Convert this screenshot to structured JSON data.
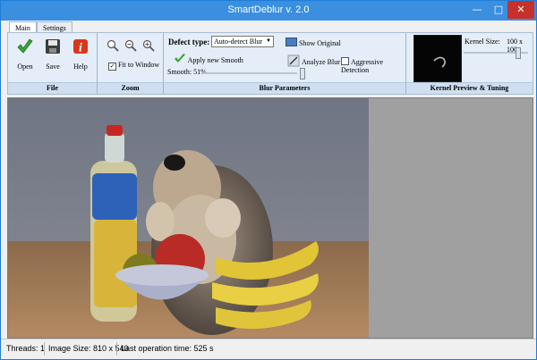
{
  "window": {
    "title": "SmartDeblur v. 2.0"
  },
  "tabs": [
    {
      "label": "Main"
    },
    {
      "label": "Settings"
    }
  ],
  "ribbon": {
    "file": {
      "label": "File",
      "open": "Open",
      "save": "Save",
      "help": "Help"
    },
    "zoom": {
      "label": "Zoom",
      "fit_to_window": "Fit to Window",
      "fit_checked": true
    },
    "blur": {
      "label": "Blur Parameters",
      "defect_type_label": "Defect type:",
      "defect_type_value": "Auto-detect Blur",
      "show_original": "Show Original",
      "apply_new_smooth": "Apply new Smooth",
      "smooth_label": "Smooth: 51%",
      "smooth_value_percent": 51,
      "analyze_blur": "Analyze Blur",
      "aggressive_detection": "Aggressive Detection",
      "aggressive_checked": false
    },
    "kernel": {
      "label": "Kernel Preview & Tuning",
      "size_label": "Kernel Size:",
      "size_value": "100 x 100"
    }
  },
  "status": {
    "threads": "Threads: 1",
    "image_size": "Image Size: 810 x 540",
    "last_time": "Last operation time: 525 s"
  },
  "colors": {
    "titlebar": "#3b8fe0",
    "ribbon": "#e4edf8",
    "close": "#c7312b"
  }
}
